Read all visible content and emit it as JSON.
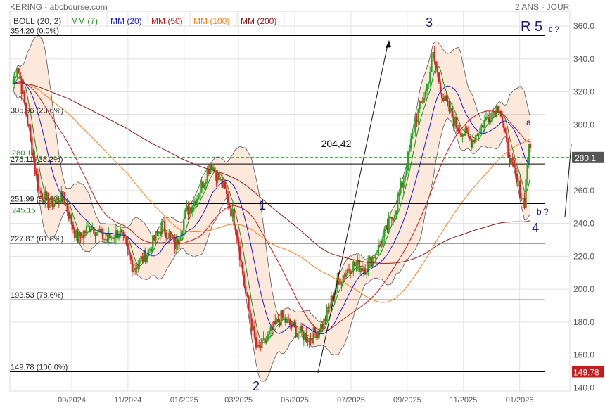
{
  "header": {
    "title": "KERING - abcbourse.com",
    "period": "2 ANS - JOUR"
  },
  "legend": [
    {
      "label": "BOLL (20, 2)",
      "color": "#333333"
    },
    {
      "label": "MM (7)",
      "color": "#1a8a1a"
    },
    {
      "label": "MM (20)",
      "color": "#1a1ae6"
    },
    {
      "label": "MM (50)",
      "color": "#cc1a1a"
    },
    {
      "label": "MM (100)",
      "color": "#ff7f1a"
    },
    {
      "label": "MM (200)",
      "color": "#8b1a1a"
    }
  ],
  "chart_data": {
    "type": "candlestick",
    "title": "KERING",
    "ylim": [
      140,
      362
    ],
    "yticks": [
      "140.0",
      "160.0",
      "180.0",
      "200.0",
      "220.0",
      "240.0",
      "260.0",
      "280.0",
      "300.0",
      "320.0",
      "340.0",
      "360.0"
    ],
    "xticks": [
      {
        "label": "09/2024",
        "t": 0
      },
      {
        "label": "11/2024",
        "t": 61
      },
      {
        "label": "01/2025",
        "t": 122
      },
      {
        "label": "03/2025",
        "t": 181
      },
      {
        "label": "05/2025",
        "t": 242
      },
      {
        "label": "07/2025",
        "t": 303
      },
      {
        "label": "09/2025",
        "t": 364
      },
      {
        "label": "11/2025",
        "t": 425
      },
      {
        "label": "01/2026",
        "t": 486
      }
    ],
    "x_unit": "days since 2024-09-01",
    "close_path": [
      [
        -64,
        325
      ],
      [
        -59,
        337
      ],
      [
        -47,
        299
      ],
      [
        -36,
        260
      ],
      [
        -24,
        252
      ],
      [
        -9,
        256
      ],
      [
        6,
        230
      ],
      [
        21,
        239
      ],
      [
        37,
        230
      ],
      [
        52,
        235
      ],
      [
        67,
        213
      ],
      [
        82,
        222
      ],
      [
        98,
        239
      ],
      [
        113,
        226
      ],
      [
        124,
        247
      ],
      [
        136,
        256
      ],
      [
        151,
        277
      ],
      [
        166,
        260
      ],
      [
        178,
        239
      ],
      [
        189,
        196
      ],
      [
        201,
        162
      ],
      [
        212,
        170
      ],
      [
        227,
        183
      ],
      [
        243,
        175
      ],
      [
        258,
        170
      ],
      [
        273,
        179
      ],
      [
        289,
        205
      ],
      [
        304,
        215
      ],
      [
        319,
        213
      ],
      [
        334,
        226
      ],
      [
        350,
        247
      ],
      [
        361,
        269
      ],
      [
        373,
        303
      ],
      [
        384,
        320
      ],
      [
        392,
        342
      ],
      [
        403,
        316
      ],
      [
        418,
        299
      ],
      [
        434,
        290
      ],
      [
        449,
        303
      ],
      [
        464,
        312
      ],
      [
        472,
        286
      ],
      [
        483,
        265
      ],
      [
        491,
        252
      ],
      [
        496,
        290
      ],
      [
        498,
        280
      ]
    ],
    "fib_levels": [
      {
        "price": 354.2,
        "label": "354.20  (0.0%)"
      },
      {
        "price": 305.96,
        "label": "305.96  (23.6%)"
      },
      {
        "price": 276.11,
        "label": "276.11  (38.2%)"
      },
      {
        "price": 251.99,
        "label": "251.99  (50.0%)"
      },
      {
        "price": 227.87,
        "label": "227.87  (61.8%)"
      },
      {
        "price": 193.53,
        "label": "193.53  (78.6%)"
      },
      {
        "price": 149.78,
        "label": "149.78  (100.0%)"
      }
    ],
    "dashed_levels": [
      {
        "price": 280.1,
        "label": "280.10"
      },
      {
        "price": 245.15,
        "label": "245.15"
      }
    ],
    "last_price": "280.1",
    "low_marker": "149.78",
    "annotations": {
      "w1": "1",
      "w2": "2",
      "w3": "3",
      "w4": "4",
      "r5": "R 5",
      "c": "c ?",
      "a": "a",
      "b": "b ?",
      "move": "204,42"
    }
  }
}
